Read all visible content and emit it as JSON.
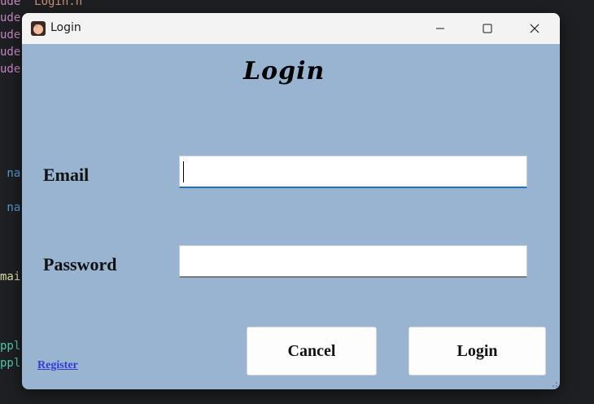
{
  "background_code": {
    "lines": [
      {
        "prefix": "ude ",
        "rest": "\"Login.h\"",
        "cls": "str"
      },
      {
        "prefix": "ude",
        "rest": "",
        "cls": ""
      },
      {
        "prefix": "ude",
        "rest": "",
        "cls": ""
      },
      {
        "prefix": "ude",
        "rest": "",
        "cls": ""
      },
      {
        "prefix": "ude",
        "rest": "",
        "cls": ""
      },
      {
        "prefix": " na",
        "rest": "",
        "cls": "blue"
      },
      {
        "prefix": " na",
        "rest": "",
        "cls": "blue"
      },
      {
        "prefix": "mai",
        "rest": "",
        "cls": "yellow"
      },
      {
        "prefix": "ppl",
        "rest": "",
        "cls": "teal"
      },
      {
        "prefix": "ppl",
        "rest": "",
        "cls": "teal"
      }
    ]
  },
  "window": {
    "title": "Login",
    "icon": "app-icon",
    "controls": {
      "minimize": "minimize-icon",
      "maximize": "maximize-icon",
      "close": "close-icon"
    }
  },
  "form": {
    "heading": "Login",
    "email_label": "Email",
    "email_value": "",
    "password_label": "Password",
    "password_value": "",
    "cancel_label": "Cancel",
    "login_label": "Login",
    "register_link": "Register"
  },
  "colors": {
    "window_bg": "#99b4d1",
    "titlebar_bg": "#f3f3f3",
    "focus_underline": "#1f6fbf",
    "link": "#2f3bd6"
  }
}
